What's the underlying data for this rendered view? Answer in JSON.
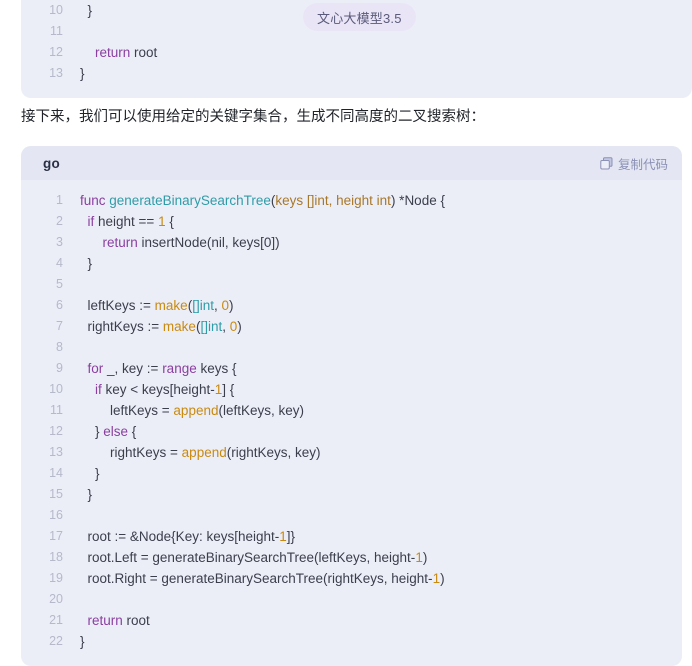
{
  "model_badge": {
    "label": "文心大模型3.5"
  },
  "paragraph": {
    "text": "接下来，我们可以使用给定的关键字集合，生成不同高度的二叉搜索树："
  },
  "top_code_block": {
    "lines": [
      {
        "no": "10",
        "segments": [
          {
            "t": "  }",
            "c": "pln"
          }
        ]
      },
      {
        "no": "11",
        "segments": [
          {
            "t": "",
            "c": "pln"
          }
        ]
      },
      {
        "no": "12",
        "segments": [
          {
            "t": "    ",
            "c": "pln"
          },
          {
            "t": "return",
            "c": "kw"
          },
          {
            "t": " root",
            "c": "pln"
          }
        ]
      },
      {
        "no": "13",
        "segments": [
          {
            "t": "}",
            "c": "pln"
          }
        ]
      }
    ]
  },
  "code_block": {
    "language": "go",
    "copy_label": "复制代码",
    "copy_icon": "copy-icon",
    "lines": [
      {
        "no": "1",
        "segments": [
          {
            "t": "func ",
            "c": "kw"
          },
          {
            "t": "generateBinarySearchTree",
            "c": "fn"
          },
          {
            "t": "(",
            "c": "pln"
          },
          {
            "t": "keys []int, height int",
            "c": "par"
          },
          {
            "t": ") *Node {",
            "c": "pln"
          }
        ]
      },
      {
        "no": "2",
        "segments": [
          {
            "t": "  ",
            "c": "pln"
          },
          {
            "t": "if",
            "c": "kw"
          },
          {
            "t": " height == ",
            "c": "pln"
          },
          {
            "t": "1",
            "c": "num"
          },
          {
            "t": " {",
            "c": "pln"
          }
        ]
      },
      {
        "no": "3",
        "segments": [
          {
            "t": "      ",
            "c": "pln"
          },
          {
            "t": "return",
            "c": "kw"
          },
          {
            "t": " insertNode(nil, keys[0])",
            "c": "pln"
          }
        ]
      },
      {
        "no": "4",
        "segments": [
          {
            "t": "  }",
            "c": "pln"
          }
        ]
      },
      {
        "no": "5",
        "segments": [
          {
            "t": "",
            "c": "pln"
          }
        ]
      },
      {
        "no": "6",
        "segments": [
          {
            "t": "  leftKeys := ",
            "c": "pln"
          },
          {
            "t": "make",
            "c": "bi"
          },
          {
            "t": "(",
            "c": "pln"
          },
          {
            "t": "[]int",
            "c": "typ"
          },
          {
            "t": ", ",
            "c": "pln"
          },
          {
            "t": "0",
            "c": "num"
          },
          {
            "t": ")",
            "c": "pln"
          }
        ]
      },
      {
        "no": "7",
        "segments": [
          {
            "t": "  rightKeys := ",
            "c": "pln"
          },
          {
            "t": "make",
            "c": "bi"
          },
          {
            "t": "(",
            "c": "pln"
          },
          {
            "t": "[]int",
            "c": "typ"
          },
          {
            "t": ", ",
            "c": "pln"
          },
          {
            "t": "0",
            "c": "num"
          },
          {
            "t": ")",
            "c": "pln"
          }
        ]
      },
      {
        "no": "8",
        "segments": [
          {
            "t": "",
            "c": "pln"
          }
        ]
      },
      {
        "no": "9",
        "segments": [
          {
            "t": "  ",
            "c": "pln"
          },
          {
            "t": "for",
            "c": "kw"
          },
          {
            "t": " _, key := ",
            "c": "pln"
          },
          {
            "t": "range",
            "c": "kw"
          },
          {
            "t": " keys {",
            "c": "pln"
          }
        ]
      },
      {
        "no": "10",
        "segments": [
          {
            "t": "    ",
            "c": "pln"
          },
          {
            "t": "if",
            "c": "kw"
          },
          {
            "t": " key < keys[height-",
            "c": "pln"
          },
          {
            "t": "1",
            "c": "num"
          },
          {
            "t": "] {",
            "c": "pln"
          }
        ]
      },
      {
        "no": "11",
        "segments": [
          {
            "t": "        leftKeys = ",
            "c": "pln"
          },
          {
            "t": "append",
            "c": "bi"
          },
          {
            "t": "(leftKeys, key)",
            "c": "pln"
          }
        ]
      },
      {
        "no": "12",
        "segments": [
          {
            "t": "    } ",
            "c": "pln"
          },
          {
            "t": "else",
            "c": "kw"
          },
          {
            "t": " {",
            "c": "pln"
          }
        ]
      },
      {
        "no": "13",
        "segments": [
          {
            "t": "        rightKeys = ",
            "c": "pln"
          },
          {
            "t": "append",
            "c": "bi"
          },
          {
            "t": "(rightKeys, key)",
            "c": "pln"
          }
        ]
      },
      {
        "no": "14",
        "segments": [
          {
            "t": "    }",
            "c": "pln"
          }
        ]
      },
      {
        "no": "15",
        "segments": [
          {
            "t": "  }",
            "c": "pln"
          }
        ]
      },
      {
        "no": "16",
        "segments": [
          {
            "t": "",
            "c": "pln"
          }
        ]
      },
      {
        "no": "17",
        "segments": [
          {
            "t": "  root := &Node{Key: keys[height-",
            "c": "pln"
          },
          {
            "t": "1",
            "c": "num"
          },
          {
            "t": "]}",
            "c": "pln"
          }
        ]
      },
      {
        "no": "18",
        "segments": [
          {
            "t": "  root.Left = generateBinarySearchTree(leftKeys, height-",
            "c": "pln"
          },
          {
            "t": "1",
            "c": "num"
          },
          {
            "t": ")",
            "c": "pln"
          }
        ]
      },
      {
        "no": "19",
        "segments": [
          {
            "t": "  root.Right = generateBinarySearchTree(rightKeys, height-",
            "c": "pln"
          },
          {
            "t": "1",
            "c": "num"
          },
          {
            "t": ")",
            "c": "pln"
          }
        ]
      },
      {
        "no": "20",
        "segments": [
          {
            "t": "",
            "c": "pln"
          }
        ]
      },
      {
        "no": "21",
        "segments": [
          {
            "t": "  ",
            "c": "pln"
          },
          {
            "t": "return",
            "c": "kw"
          },
          {
            "t": " root",
            "c": "pln"
          }
        ]
      },
      {
        "no": "22",
        "segments": [
          {
            "t": "}",
            "c": "pln"
          }
        ]
      }
    ]
  },
  "colors": {
    "code_bg": "#eceef7",
    "code_header_bg": "#e4e7f3",
    "badge_bg": "#e9e5f7",
    "keyword": "#8a3fa0",
    "function": "#2f9ca8",
    "builtin": "#c98a10",
    "number": "#c98a10",
    "param": "#a8782a",
    "plain": "#3b3f4c",
    "line_number": "#b5b9ca",
    "page_text": "#1f2329"
  }
}
